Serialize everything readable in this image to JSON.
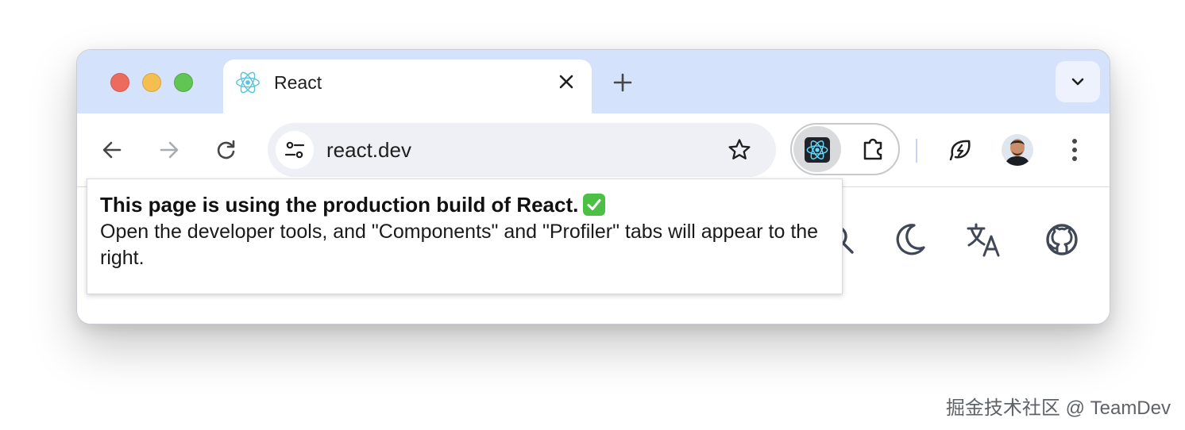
{
  "tab": {
    "title": "React",
    "favicon": "react-logo-icon",
    "close_icon": "close-icon"
  },
  "new_tab_icon": "plus-icon",
  "tab_search_icon": "chevron-down-icon",
  "toolbar": {
    "back_icon": "arrow-left-icon",
    "forward_icon": "arrow-right-icon",
    "reload_icon": "reload-icon",
    "site_info_icon": "tune-icon",
    "url": "react.dev",
    "bookmark_icon": "star-icon",
    "extensions": [
      {
        "name": "React Developer Tools",
        "icon": "react-devtools-icon"
      },
      {
        "name": "Extensions",
        "icon": "puzzle-icon"
      }
    ],
    "performance_icon": "lightning-leaf-icon",
    "profile_icon": "avatar",
    "menu_icon": "kebab-menu-icon"
  },
  "site_header_icons": [
    "search-icon",
    "moon-icon",
    "translate-icon",
    "github-icon"
  ],
  "popup": {
    "title": "This page is using the production build of React.",
    "badge_icon": "checkmark-icon",
    "body": "Open the developer tools, and \"Components\" and \"Profiler\" tabs will appear to the right."
  },
  "watermark": "掘金技术社区 @ TeamDev",
  "colors": {
    "tabstrip": "#d5e2fb",
    "react_accent": "#58c4dc",
    "check_green": "#4cc045"
  }
}
